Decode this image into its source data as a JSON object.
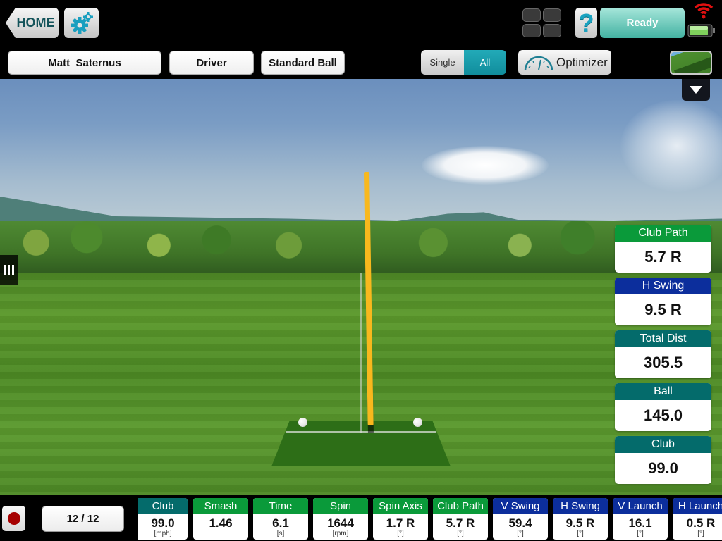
{
  "colors": {
    "teal_header": "#046b6b",
    "green_header": "#0a9a3a",
    "blue_header": "#0c2e9c",
    "ready_accent": "#43b2a2",
    "segment_active": "#118d9c",
    "trace": "#f8b81d",
    "record": "#a60000"
  },
  "topbar": {
    "home_label": "HOME",
    "settings_icon": "gear-icon",
    "layout_icon": "grid-icon",
    "help_label": "?",
    "status_label": "Ready",
    "wifi_icon": "wifi-icon",
    "battery_icon": "battery-icon",
    "player_name": "Matt  Saternus",
    "club": "Driver",
    "ball": "Standard Ball",
    "view_mode": {
      "options": [
        "Single",
        "All"
      ],
      "selected": "All"
    },
    "optimizer_label": "Optimizer",
    "range_view_icon": "range-thumbnail-icon"
  },
  "scene": {
    "menu_icon": "triangle-down-icon",
    "side_handle_icon": "drawer-handle-icon"
  },
  "stat_cards": [
    {
      "label": "Club Path",
      "value": "5.7 R",
      "color": "green"
    },
    {
      "label": "H Swing",
      "value": "9.5 R",
      "color": "blue"
    },
    {
      "label": "Total Dist",
      "value": "305.5",
      "color": "teal"
    },
    {
      "label": "Ball",
      "value": "145.0",
      "color": "teal"
    },
    {
      "label": "Club",
      "value": "99.0",
      "color": "teal"
    }
  ],
  "bottombar": {
    "record_icon": "record-icon",
    "shot_counter": "12 / 12",
    "metrics": [
      {
        "label": "Club",
        "value": "99.0",
        "unit": "[mph]",
        "color": "teal"
      },
      {
        "label": "Smash",
        "value": "1.46",
        "unit": "",
        "color": "green"
      },
      {
        "label": "Time",
        "value": "6.1",
        "unit": "[s]",
        "color": "green"
      },
      {
        "label": "Spin",
        "value": "1644",
        "unit": "[rpm]",
        "color": "green"
      },
      {
        "label": "Spin Axis",
        "value": "1.7 R",
        "unit": "[°]",
        "color": "green"
      },
      {
        "label": "Club Path",
        "value": "5.7 R",
        "unit": "[°]",
        "color": "green"
      },
      {
        "label": "V Swing",
        "value": "59.4",
        "unit": "[°]",
        "color": "blue"
      },
      {
        "label": "H Swing",
        "value": "9.5 R",
        "unit": "[°]",
        "color": "blue"
      },
      {
        "label": "V Launch",
        "value": "16.1",
        "unit": "[°]",
        "color": "blue"
      },
      {
        "label": "H Launch",
        "value": "0.5 R",
        "unit": "[°]",
        "color": "blue"
      }
    ]
  }
}
